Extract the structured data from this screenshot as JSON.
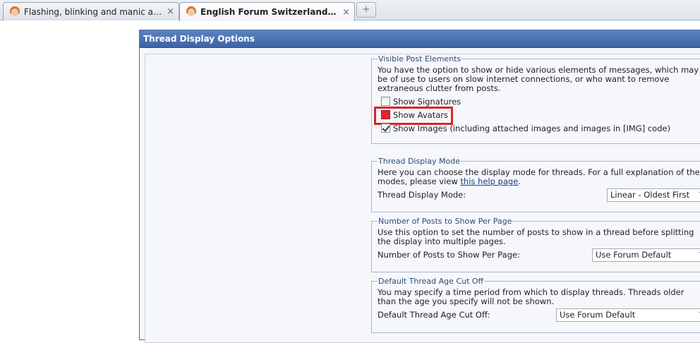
{
  "tabs": [
    {
      "title": "Flashing, blinking and manic avatar...",
      "close": "×"
    },
    {
      "title": "English Forum Switzerland - Edit ...",
      "close": "×"
    }
  ],
  "new_tab_glyph": "+",
  "panel": {
    "header": "Thread Display Options",
    "visible_post": {
      "legend": "Visible Post Elements",
      "description": "You have the option to show or hide various elements of messages, which may be of use to users on slow internet connections, or who want to remove extraneous clutter from posts.",
      "options": [
        {
          "label": "Show Signatures",
          "checked": false
        },
        {
          "label": "Show Avatars",
          "checked": true
        },
        {
          "label": "Show Images (including attached images and images in [IMG] code)",
          "checked": true
        }
      ]
    },
    "thread_mode": {
      "legend": "Thread Display Mode",
      "description_before": "Here you can choose the display mode for threads. For a full explanation of the modes, please view ",
      "link": "this help page",
      "description_after": ".",
      "label": "Thread Display Mode:",
      "value": "Linear - Oldest First"
    },
    "posts_per_page": {
      "legend": "Number of Posts to Show Per Page",
      "description": "Use this option to set the number of posts to show in a thread before splitting the display into multiple pages.",
      "label": "Number of Posts to Show Per Page:",
      "value": "Use Forum Default"
    },
    "age_cutoff": {
      "legend": "Default Thread Age Cut Off",
      "description": "You may specify a time period from which to display threads. Threads older than the age you specify will not be shown.",
      "label": "Default Thread Age Cut Off:",
      "value": "Use Forum Default"
    }
  },
  "colors": {
    "header": "#4a72b5",
    "highlight": "#d8252b",
    "legend": "#2d4a7a"
  }
}
